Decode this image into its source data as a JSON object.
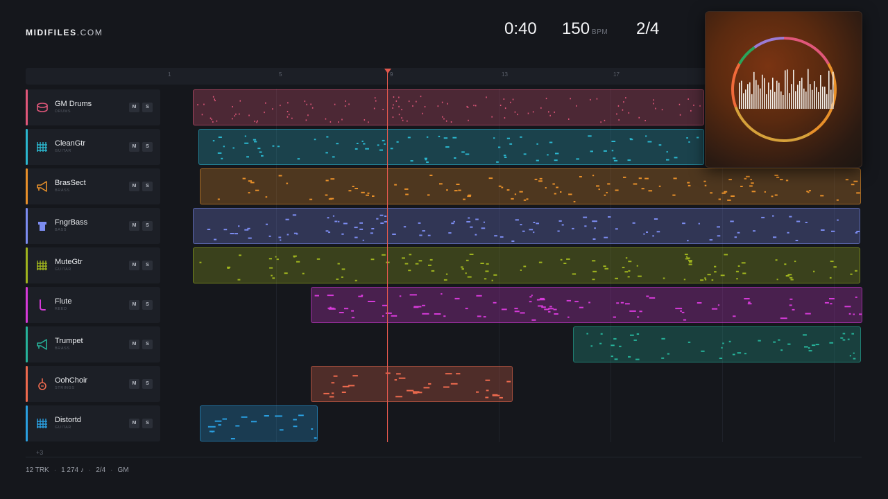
{
  "brand": {
    "name": "MIDIFILES",
    "suffix": ".COM"
  },
  "transport": {
    "time": "0:40",
    "bpm": "150",
    "bpm_unit": "BPM",
    "signature": "2/4"
  },
  "ruler": {
    "ticks": [
      "1",
      "5",
      "9",
      "13",
      "17"
    ]
  },
  "tracks": [
    {
      "name": "GM Drums",
      "type": "DRUMS",
      "mute": "M",
      "solo": "S",
      "color": "#e0577a",
      "icon": "drum-icon"
    },
    {
      "name": "CleanGtr",
      "type": "GUITAR",
      "mute": "M",
      "solo": "S",
      "color": "#2bb7cf",
      "icon": "guitar-grid-icon"
    },
    {
      "name": "BrasSect",
      "type": "BRASS",
      "mute": "M",
      "solo": "S",
      "color": "#e8902a",
      "icon": "horn-icon"
    },
    {
      "name": "FngrBass",
      "type": "BASS",
      "mute": "M",
      "solo": "S",
      "color": "#7c8cf0",
      "icon": "bass-icon"
    },
    {
      "name": "MuteGtr",
      "type": "GUITAR",
      "mute": "M",
      "solo": "S",
      "color": "#9fb41e",
      "icon": "guitar-grid-icon"
    },
    {
      "name": "Flute",
      "type": "REED",
      "mute": "M",
      "solo": "S",
      "color": "#d53ad8",
      "icon": "flute-icon"
    },
    {
      "name": "Trumpet",
      "type": "BRASS",
      "mute": "M",
      "solo": "S",
      "color": "#26b39a",
      "icon": "horn-icon"
    },
    {
      "name": "OohChoir",
      "type": "STRINGS",
      "mute": "M",
      "solo": "S",
      "color": "#ee6a4e",
      "icon": "violin-icon"
    },
    {
      "name": "Distortd",
      "type": "GUITAR",
      "mute": "M",
      "solo": "S",
      "color": "#2a9fe0",
      "icon": "guitar-grid-icon"
    }
  ],
  "more_tracks": "+3",
  "footer": {
    "tracks": "12 TRK",
    "notes": "1 274 ♪",
    "signature": "2/4",
    "standard": "GM"
  }
}
